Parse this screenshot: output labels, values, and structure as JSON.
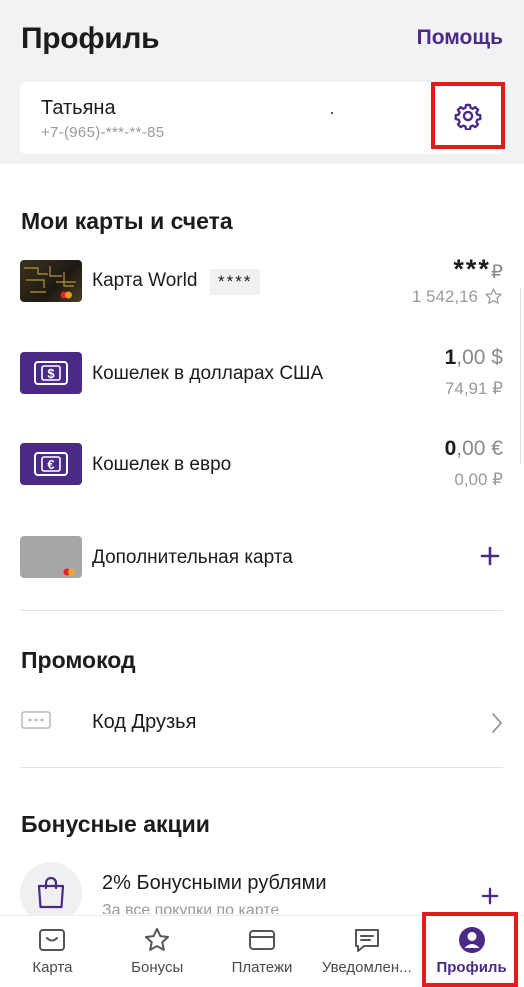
{
  "header": {
    "title": "Профиль",
    "help_label": "Помощь"
  },
  "profile": {
    "name": "Татьяна",
    "phone": "+7-(965)-***-**-85",
    "settings_icon": "gear-icon"
  },
  "cards_section": {
    "title": "Мои карты и счета",
    "items": [
      {
        "label": "Карта World",
        "masked_number": "****",
        "amount_main": "***",
        "amount_currency": "₽",
        "sub_amount": "1 542,16",
        "sub_icon": "star-icon"
      },
      {
        "label": "Кошелек в долларах США",
        "amount_int": "1",
        "amount_frac": ",00 $",
        "sub_amount": "74,91 ₽"
      },
      {
        "label": "Кошелек в евро",
        "amount_int": "0",
        "amount_frac": ",00 €",
        "sub_amount": "0,00 ₽"
      },
      {
        "label": "Дополнительная карта",
        "action_icon": "plus-icon"
      }
    ]
  },
  "promo_section": {
    "title": "Промокод",
    "item_label": "Код Друзья"
  },
  "bonus_section": {
    "title": "Бонусные акции",
    "item_title": "2% Бонусными рублями",
    "item_subtitle": "За все покупки по карте"
  },
  "bottom_nav": {
    "items": [
      {
        "label": "Карта",
        "icon": "card-icon"
      },
      {
        "label": "Бонусы",
        "icon": "star-icon"
      },
      {
        "label": "Платежи",
        "icon": "wallet-icon"
      },
      {
        "label": "Уведомлен...",
        "icon": "message-icon"
      },
      {
        "label": "Профиль",
        "icon": "profile-icon",
        "active": true
      }
    ]
  },
  "colors": {
    "accent": "#4a2a86",
    "highlight_box": "#e51a1a",
    "top_background": "#f2f2f4"
  }
}
